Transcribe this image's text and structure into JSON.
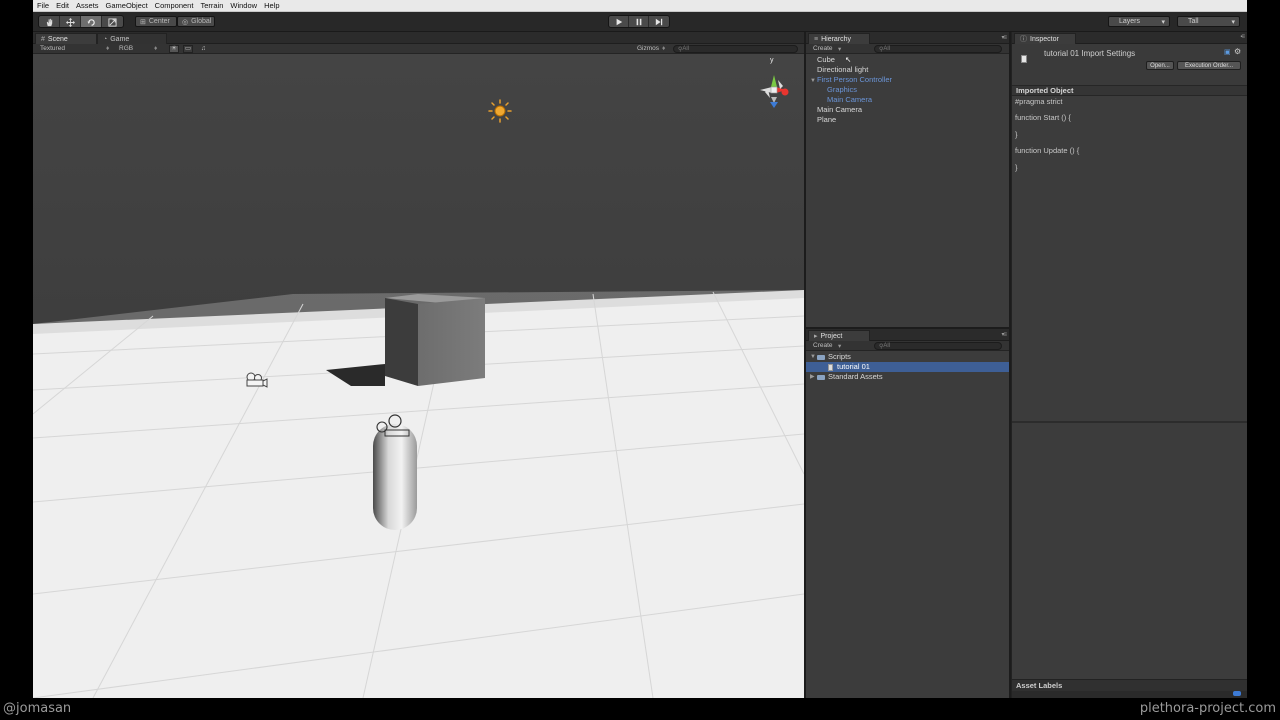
{
  "menu": [
    "File",
    "Edit",
    "Assets",
    "GameObject",
    "Component",
    "Terrain",
    "Window",
    "Help"
  ],
  "toolbar": {
    "tools": [
      "hand-icon",
      "move-icon",
      "rotate-icon",
      "scale-icon"
    ],
    "pivot_label": "Center",
    "space_label": "Global",
    "layers_label": "Layers",
    "layout_label": "Tall"
  },
  "scene": {
    "tab_scene": "Scene",
    "tab_game": "Game",
    "shading": "Textured",
    "render_mode": "RGB",
    "gizmos_label": "Gizmos",
    "search_placeholder": "All",
    "gizmo_y": "y"
  },
  "hierarchy": {
    "tab": "Hierarchy",
    "create": "Create",
    "search_placeholder": "All",
    "items": [
      {
        "label": "Cube"
      },
      {
        "label": "Directional light"
      },
      {
        "label": "First Person Controller"
      },
      {
        "label": "Graphics"
      },
      {
        "label": "Main Camera"
      },
      {
        "label": "Main Camera"
      },
      {
        "label": "Plane"
      }
    ]
  },
  "project": {
    "tab": "Project",
    "create": "Create",
    "search_placeholder": "All",
    "items": [
      {
        "label": "Scripts"
      },
      {
        "label": "tutorial 01"
      },
      {
        "label": "Standard Assets"
      }
    ]
  },
  "inspector": {
    "tab": "Inspector",
    "title": "tutorial 01 Import Settings",
    "open_button": "Open...",
    "execution_order_button": "Execution Order...",
    "section": "Imported Object",
    "code": [
      "#pragma strict",
      "",
      "function Start () {",
      "",
      "}",
      "",
      "function Update () {",
      "",
      "}"
    ],
    "asset_labels": "Asset Labels"
  },
  "watermark": {
    "left": "@jomasan",
    "right": "plethora-project.com"
  }
}
